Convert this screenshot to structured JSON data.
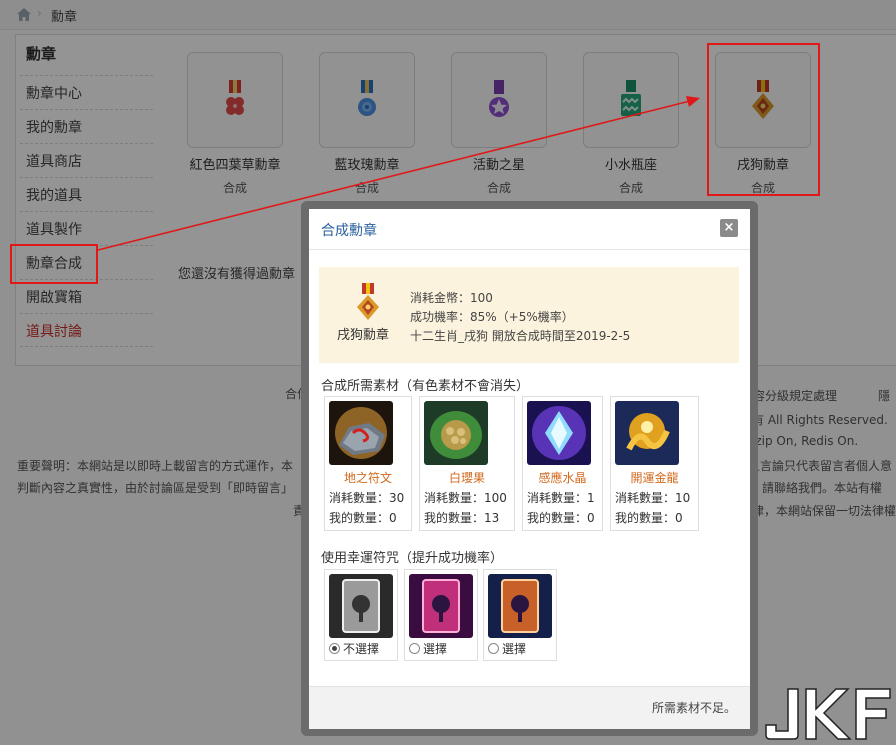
{
  "breadcrumb": {
    "current": "勳章"
  },
  "sidebar": {
    "title": "勳章",
    "items": [
      {
        "label": "勳章中心"
      },
      {
        "label": "我的勳章"
      },
      {
        "label": "道具商店"
      },
      {
        "label": "我的道具"
      },
      {
        "label": "道具製作"
      },
      {
        "label": "勳章合成"
      },
      {
        "label": "開啟寶箱"
      },
      {
        "label": "道具討論"
      }
    ]
  },
  "medals": [
    {
      "name": "紅色四葉草勳章",
      "action": "合成"
    },
    {
      "name": "藍玫瑰勳章",
      "action": "合成"
    },
    {
      "name": "活動之星",
      "action": "合成"
    },
    {
      "name": "小水瓶座",
      "action": "合成"
    },
    {
      "name": "戌狗勳章",
      "action": "合成"
    }
  ],
  "empty_message": "您還沒有獲得過勳章",
  "footer": {
    "l1a": "合作",
    "l1b": "內容分級規定處理",
    "l1c": "隱",
    "l2": "有 All Rights Reserved.",
    "l3": "izip On, Redis On.",
    "l4a": "重要聲明：本網站是以即時上載留言的方式運作，本",
    "l4b": "之言論只代表留言者個人意",
    "l5a": "判斷內容之真實性，由於討論區是受到「即時留言」",
    "l5b": "，請聯絡我們。本站有權",
    "l6a": "責",
    "l6b": "律，本網站保留一切法律權"
  },
  "modal": {
    "title": "合成勳章",
    "close": "×",
    "target": {
      "name": "戌狗勳章",
      "cost": "消耗金幣：100",
      "rate": "成功機率：85%（+5%機率）",
      "note": "十二生肖_戌狗 開放合成時間至2019-2-5"
    },
    "materials_title": "合成所需素材（有色素材不會消失）",
    "materials": [
      {
        "name": "地之符文",
        "consume": "消耗數量：30",
        "own": "我的數量：0"
      },
      {
        "name": "白瓔果",
        "consume": "消耗數量：100",
        "own": "我的數量：13"
      },
      {
        "name": "感應水晶",
        "consume": "消耗數量：1",
        "own": "我的數量：0"
      },
      {
        "name": "開運金龍",
        "consume": "消耗數量：10",
        "own": "我的數量：0"
      }
    ],
    "charms_title": "使用幸運符咒（提升成功機率）",
    "charms": [
      {
        "label": "不選擇",
        "selected": true,
        "color": "#9a9a9a"
      },
      {
        "label": "選擇",
        "selected": false,
        "color": "#c0307a"
      },
      {
        "label": "選擇",
        "selected": false,
        "color": "#c8602a"
      }
    ],
    "footer_message": "所需素材不足。"
  },
  "watermark": "JKF",
  "colors": {
    "highlight": "#e01818",
    "link_red": "#c9302c",
    "title_blue": "#2a5f9e",
    "material_orange": "#d2691e"
  }
}
